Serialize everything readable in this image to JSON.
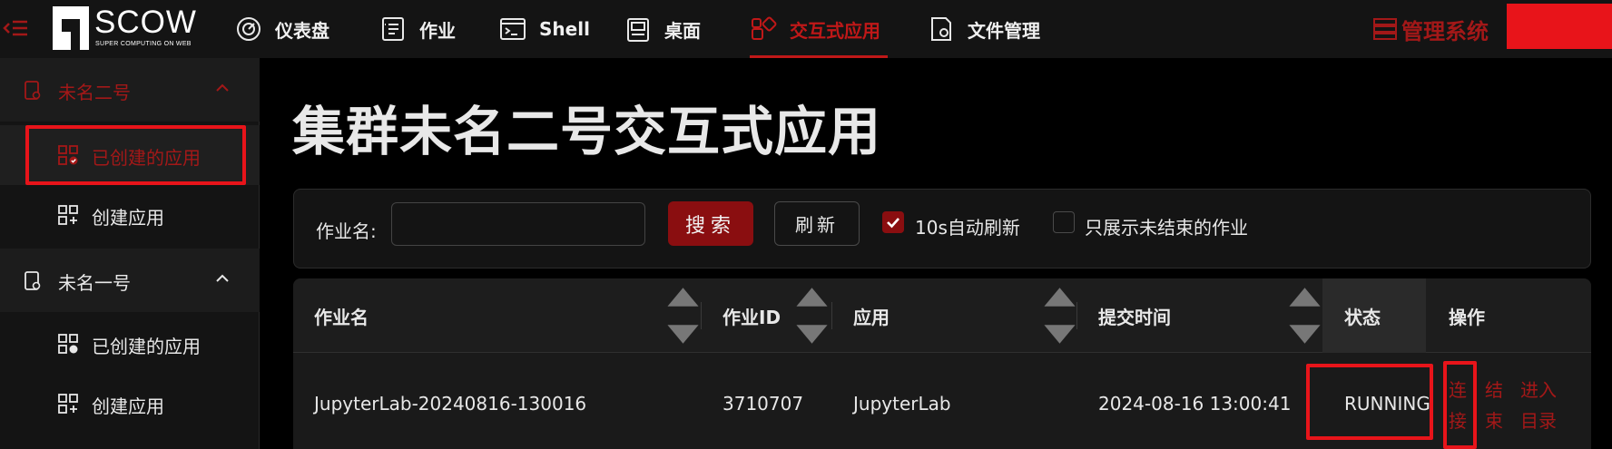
{
  "header": {
    "logo_text": "SCOW",
    "logo_subtitle": "SUPER COMPUTING ON WEB",
    "nav": [
      {
        "label": "仪表盘",
        "icon": "dashboard-icon"
      },
      {
        "label": "作业",
        "icon": "job-icon"
      },
      {
        "label": "Shell",
        "icon": "terminal-icon"
      },
      {
        "label": "桌面",
        "icon": "desktop-icon"
      },
      {
        "label": "交互式应用",
        "icon": "apps-icon",
        "active": true
      },
      {
        "label": "文件管理",
        "icon": "file-icon"
      }
    ],
    "admin_label": "管理系统"
  },
  "sidebar": {
    "groups": [
      {
        "label": "未名二号",
        "items": [
          {
            "label": "已创建的应用"
          },
          {
            "label": "创建应用"
          }
        ]
      },
      {
        "label": "未名一号",
        "items": [
          {
            "label": "已创建的应用"
          },
          {
            "label": "创建应用"
          }
        ]
      }
    ]
  },
  "main": {
    "title": "集群未名二号交互式应用",
    "filter": {
      "job_name_label": "作业名:",
      "job_name_value": "",
      "search_label": "搜索",
      "refresh_label": "刷新",
      "auto_refresh_label": "10s自动刷新",
      "auto_refresh_checked": true,
      "only_unfinished_label": "只展示未结束的作业",
      "only_unfinished_checked": false
    },
    "table": {
      "columns": [
        "作业名",
        "作业ID",
        "应用",
        "提交时间",
        "状态",
        "操作"
      ],
      "rows": [
        {
          "job_name": "JupyterLab-20240816-130016",
          "job_id": "3710707",
          "app": "JupyterLab",
          "submit_time": "2024-08-16 13:00:41",
          "status": "RUNNING",
          "actions": [
            "连接",
            "结束",
            "进入目录"
          ]
        }
      ]
    }
  },
  "colors": {
    "accent": "#a31818",
    "highlight": "#e8141a",
    "button_primary": "#8a0e10"
  }
}
